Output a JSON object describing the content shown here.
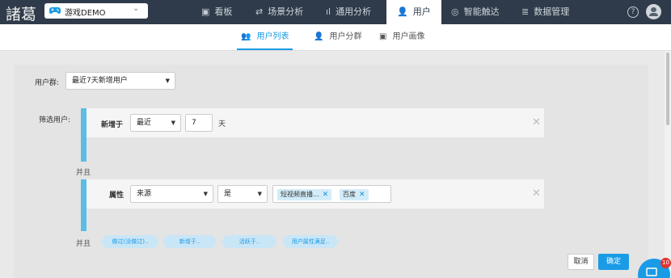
{
  "app": {
    "logo": "諸葛"
  },
  "project": {
    "name": "游戏DEMO",
    "chevron": "⌄"
  },
  "nav": {
    "items": [
      {
        "label": "看板",
        "icon": "dashboard-icon"
      },
      {
        "label": "场景分析",
        "icon": "scene-icon"
      },
      {
        "label": "通用分析",
        "icon": "bar-chart-icon"
      },
      {
        "label": "用户",
        "icon": "user-icon",
        "active": true
      },
      {
        "label": "智能触达",
        "icon": "reach-icon"
      },
      {
        "label": "数据管理",
        "icon": "database-icon"
      }
    ]
  },
  "subnav": {
    "items": [
      {
        "label": "用户列表",
        "active": true
      },
      {
        "label": "用户分群"
      },
      {
        "label": "用户画像"
      }
    ]
  },
  "filter": {
    "group_label": "用户群:",
    "group_value": "最近7天新增用户",
    "filter_label": "筛选用户:",
    "rule1": {
      "label": "新增于",
      "range": "最近",
      "number": "7",
      "unit": "天"
    },
    "and1": "并且",
    "rule2": {
      "label": "属性",
      "property": "来源",
      "operator": "是",
      "tags": [
        "短视频直播...",
        "百度"
      ]
    },
    "and2": "并且",
    "pills": [
      "做过(没做过)..",
      "新增于..",
      "活跃于..",
      "用户属性满足.."
    ]
  },
  "buttons": {
    "cancel": "取消",
    "confirm": "确定"
  },
  "chat": {
    "badge": "10"
  },
  "colors": {
    "nav_bg": "#2f3b4a",
    "accent": "#1a9be6",
    "bar": "#5bbde6"
  }
}
